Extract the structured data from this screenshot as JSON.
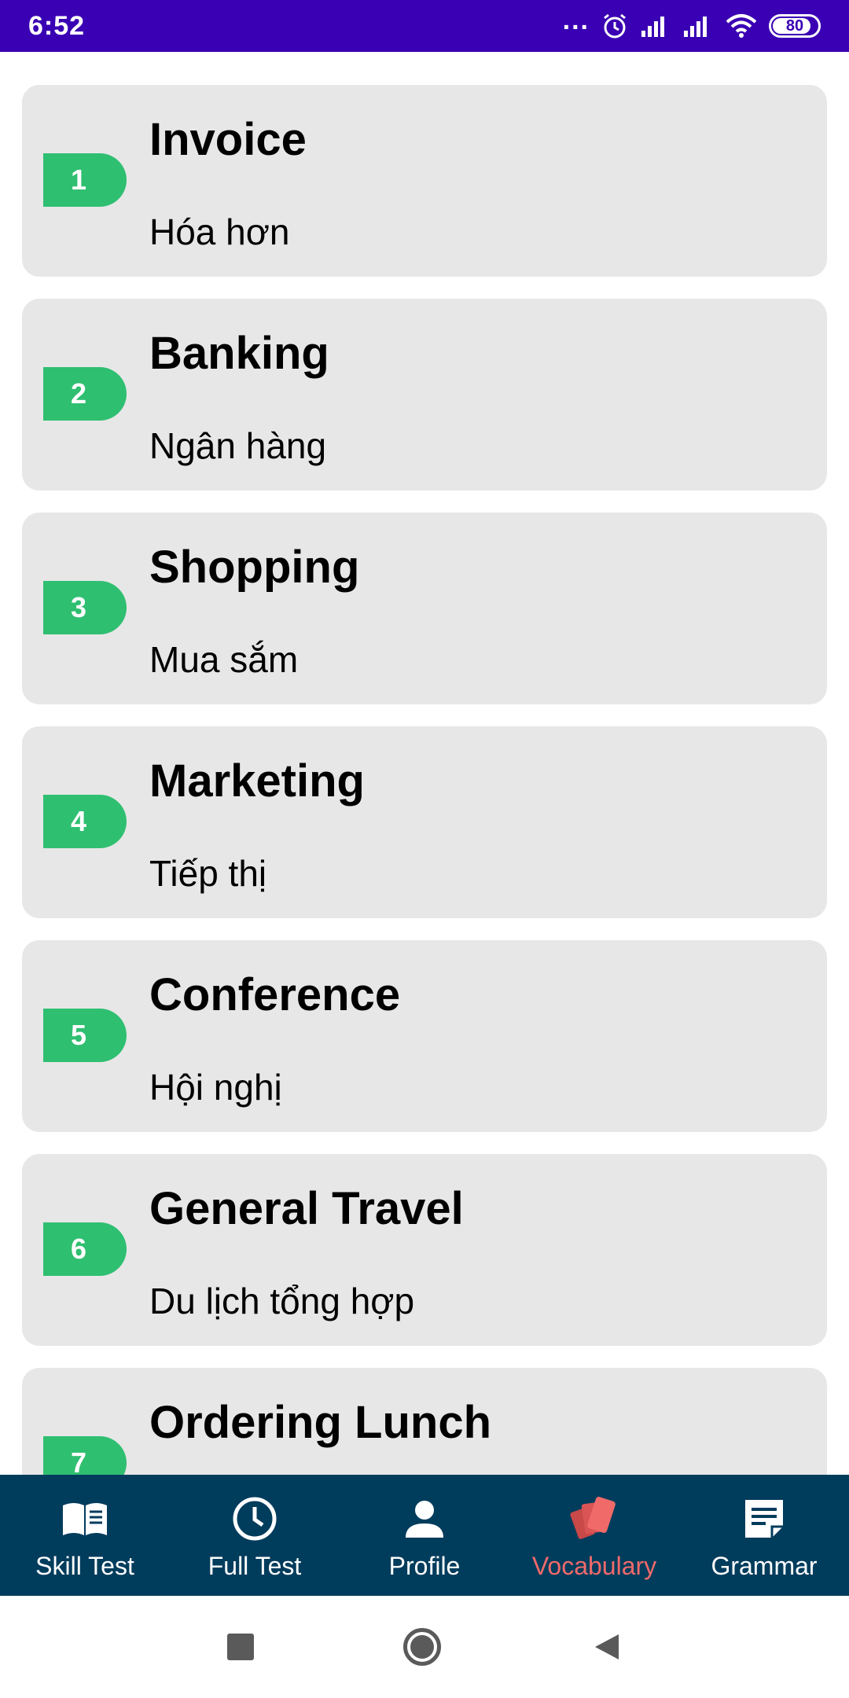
{
  "status_bar": {
    "time": "6:52",
    "dots": "...",
    "battery": "80"
  },
  "items": [
    {
      "num": "1",
      "title": "Invoice",
      "subtitle": "Hóa hơn"
    },
    {
      "num": "2",
      "title": "Banking",
      "subtitle": "Ngân hàng"
    },
    {
      "num": "3",
      "title": "Shopping",
      "subtitle": "Mua sắm"
    },
    {
      "num": "4",
      "title": "Marketing",
      "subtitle": "Tiếp thị"
    },
    {
      "num": "5",
      "title": "Conference",
      "subtitle": "Hội nghị"
    },
    {
      "num": "6",
      "title": "General Travel",
      "subtitle": "Du lịch tổng hợp"
    },
    {
      "num": "7",
      "title": "Ordering Lunch",
      "subtitle": ""
    }
  ],
  "bottom_nav": {
    "items": [
      {
        "label": "Skill Test",
        "icon": "book-icon"
      },
      {
        "label": "Full Test",
        "icon": "clock-icon"
      },
      {
        "label": "Profile",
        "icon": "person-icon"
      },
      {
        "label": "Vocabulary",
        "icon": "cards-icon"
      },
      {
        "label": "Grammar",
        "icon": "note-icon"
      }
    ],
    "active_index": 3
  },
  "colors": {
    "status_bar": "#3a00b3",
    "badge": "#2fbf71",
    "card": "#e7e7e7",
    "bottom_nav": "#003c5c",
    "active": "#f06a6a"
  }
}
